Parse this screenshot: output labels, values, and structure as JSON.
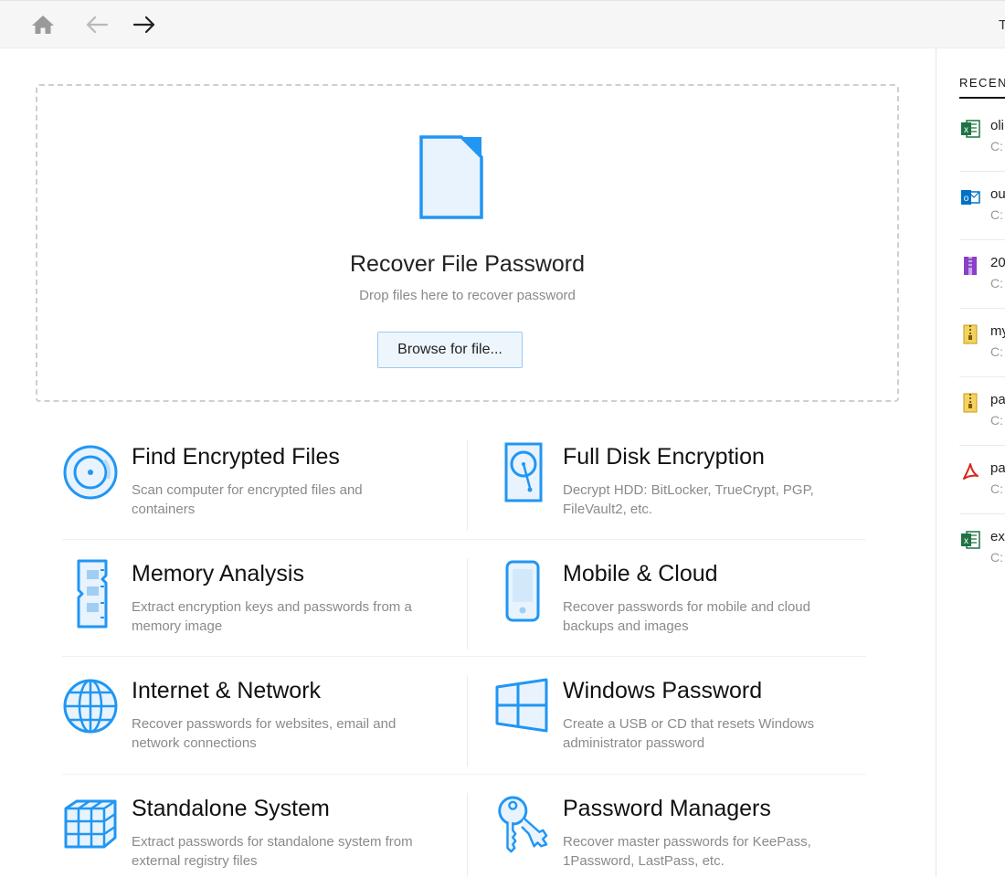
{
  "toolbar": {
    "home_icon": "home-icon",
    "back_icon": "arrow-left-icon",
    "forward_icon": "arrow-right-icon",
    "title_fragment": "T"
  },
  "dropzone": {
    "icon": "document-icon",
    "title": "Recover File Password",
    "subtitle": "Drop files here to recover password",
    "browse_label": "Browse for file..."
  },
  "tools": [
    {
      "title": "Find Encrypted Files",
      "desc": "Scan computer for encrypted files and containers",
      "icon": "disc-search-icon"
    },
    {
      "title": "Full Disk Encryption",
      "desc": "Decrypt HDD: BitLocker, TrueCrypt, PGP, FileVault2, etc.",
      "icon": "hard-disk-icon"
    },
    {
      "title": "Memory Analysis",
      "desc": "Extract encryption keys and passwords from a memory image",
      "icon": "memory-chip-icon"
    },
    {
      "title": "Mobile & Cloud",
      "desc": "Recover passwords for mobile and cloud backups and images",
      "icon": "mobile-phone-icon"
    },
    {
      "title": "Internet & Network",
      "desc": "Recover passwords for websites, email and network connections",
      "icon": "globe-icon"
    },
    {
      "title": "Windows Password",
      "desc": "Create a USB or CD that resets Windows administrator password",
      "icon": "windows-logo-icon"
    },
    {
      "title": "Standalone System",
      "desc": "Extract passwords for standalone system from external registry files",
      "icon": "cubes-icon"
    },
    {
      "title": "Password Managers",
      "desc": "Recover master passwords for KeePass, 1Password, LastPass, etc.",
      "icon": "keys-icon"
    }
  ],
  "recent": {
    "heading": "RECEN",
    "items": [
      {
        "name": "oli",
        "path": "C:",
        "type": "excel",
        "icon": "excel-file-icon",
        "color": "#1f7244"
      },
      {
        "name": "ou",
        "path": "C:",
        "type": "outlook",
        "icon": "outlook-file-icon",
        "color": "#0072c6"
      },
      {
        "name": "20",
        "path": "C:",
        "type": "rar",
        "icon": "rar-archive-icon",
        "color": "#8a3fc8"
      },
      {
        "name": "my",
        "path": "C:",
        "type": "zip",
        "icon": "zip-archive-icon",
        "color": "#e8b923"
      },
      {
        "name": "pa",
        "path": "C:",
        "type": "zip",
        "icon": "zip-archive-icon",
        "color": "#e8b923"
      },
      {
        "name": "pa",
        "path": "C:",
        "type": "pdf",
        "icon": "pdf-file-icon",
        "color": "#d9261c"
      },
      {
        "name": "ex",
        "path": "C:",
        "type": "excel",
        "icon": "excel-file-icon",
        "color": "#1f7244"
      }
    ]
  },
  "colors": {
    "accent": "#2196f3",
    "icon_fill": "#e8f3fd",
    "button_bg": "#eef6fd",
    "button_border": "#9ccaf0"
  }
}
